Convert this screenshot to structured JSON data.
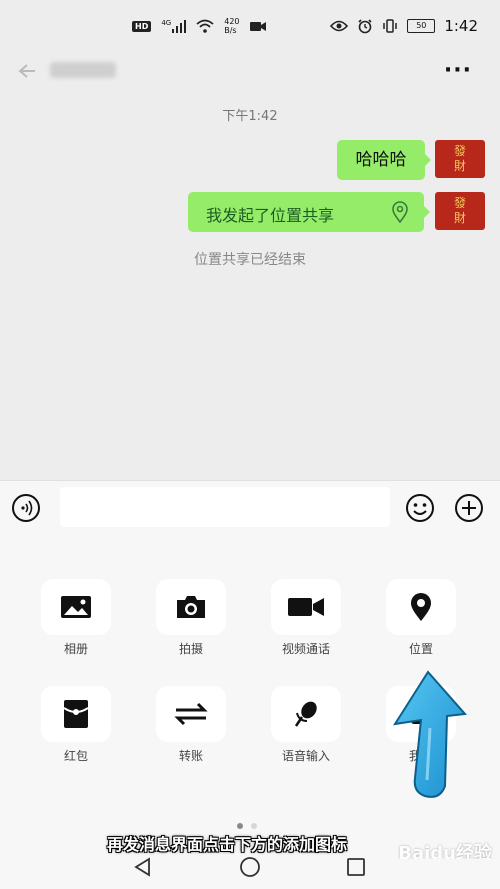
{
  "status_bar": {
    "hd": "HD",
    "network": "4G",
    "speed_value": "420",
    "speed_unit": "B/s",
    "battery": "50",
    "time": "1:42"
  },
  "chat": {
    "title_blurred": "",
    "time_label": "下午1:42",
    "messages": [
      {
        "text": "哈哈哈"
      },
      {
        "text": "我发起了位置共享",
        "icon": "location-pin-icon"
      }
    ],
    "avatar_text": [
      "發",
      "財"
    ],
    "system_message": "位置共享已经结束"
  },
  "panel": {
    "items": [
      {
        "label": "相册",
        "icon": "image-icon"
      },
      {
        "label": "拍摄",
        "icon": "camera-icon"
      },
      {
        "label": "视频通话",
        "icon": "video-icon"
      },
      {
        "label": "位置",
        "icon": "location-icon"
      },
      {
        "label": "红包",
        "icon": "red-packet-icon"
      },
      {
        "label": "转账",
        "icon": "transfer-icon"
      },
      {
        "label": "语音输入",
        "icon": "microphone-icon"
      },
      {
        "label": "我的",
        "icon": "my-icon"
      }
    ]
  },
  "caption": "再发消息界面点击下方的添加图标",
  "watermark": "Baidu经验",
  "colors": {
    "bubble": "#95ec69",
    "background": "#ededed",
    "arrow": "#2aa7e0"
  }
}
